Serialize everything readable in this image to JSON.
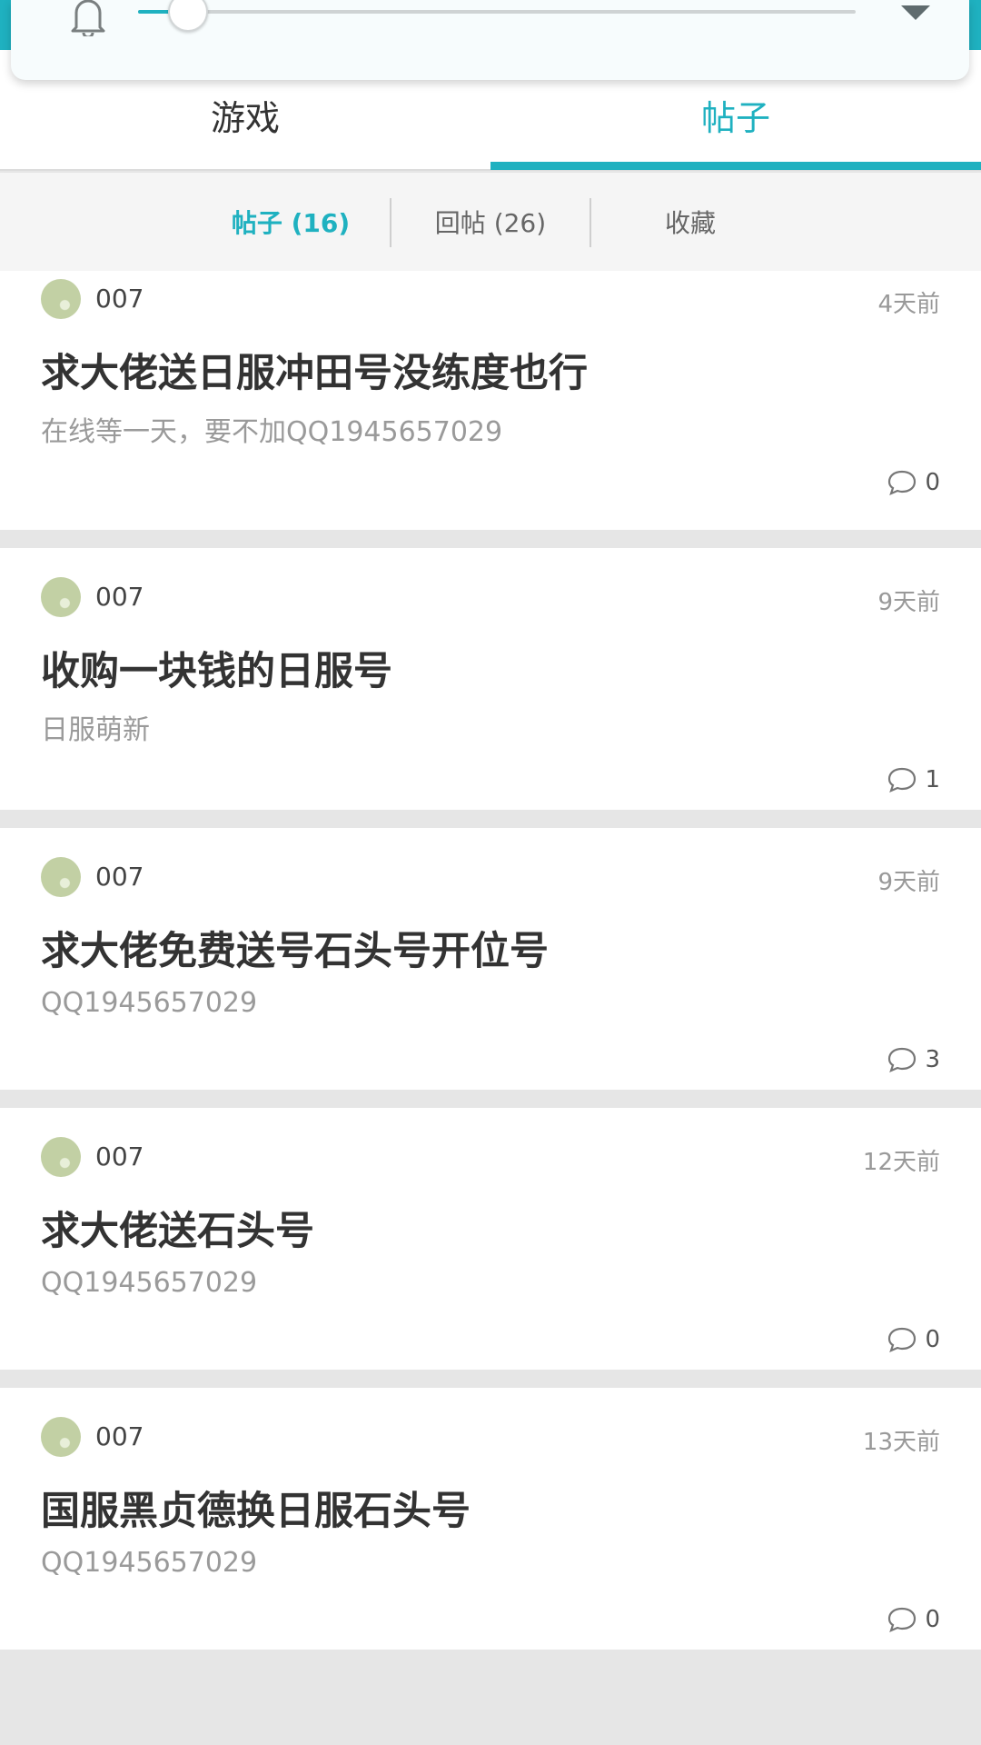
{
  "colors": {
    "accent": "#1fb1c0",
    "text": "#333333",
    "muted": "#9a9a9a"
  },
  "volume": {
    "level": 0.07,
    "icons": [
      "bell-icon",
      "chevron-down-icon"
    ]
  },
  "tabs": [
    {
      "label": "游戏",
      "active": false
    },
    {
      "label": "帖子",
      "active": true
    }
  ],
  "subtabs": [
    {
      "label": "帖子 (16)",
      "active": true
    },
    {
      "label": "回帖 (26)",
      "active": false
    },
    {
      "label": "收藏",
      "active": false
    }
  ],
  "posts": [
    {
      "author": "007",
      "time": "4天前",
      "title": "求大佬送日服冲田号没练度也行",
      "excerpt": "在线等一天，要不加QQ1945657029",
      "comments": "0"
    },
    {
      "author": "007",
      "time": "9天前",
      "title": "收购一块钱的日服号",
      "excerpt": "日服萌新",
      "comments": "1"
    },
    {
      "author": "007",
      "time": "9天前",
      "title": "求大佬免费送号石头号开位号",
      "excerpt": "QQ1945657029",
      "comments": "3"
    },
    {
      "author": "007",
      "time": "12天前",
      "title": "求大佬送石头号",
      "excerpt": "QQ1945657029",
      "comments": "0"
    },
    {
      "author": "007",
      "time": "13天前",
      "title": "国服黑贞德换日服石头号",
      "excerpt": "QQ1945657029",
      "comments": "0"
    }
  ]
}
